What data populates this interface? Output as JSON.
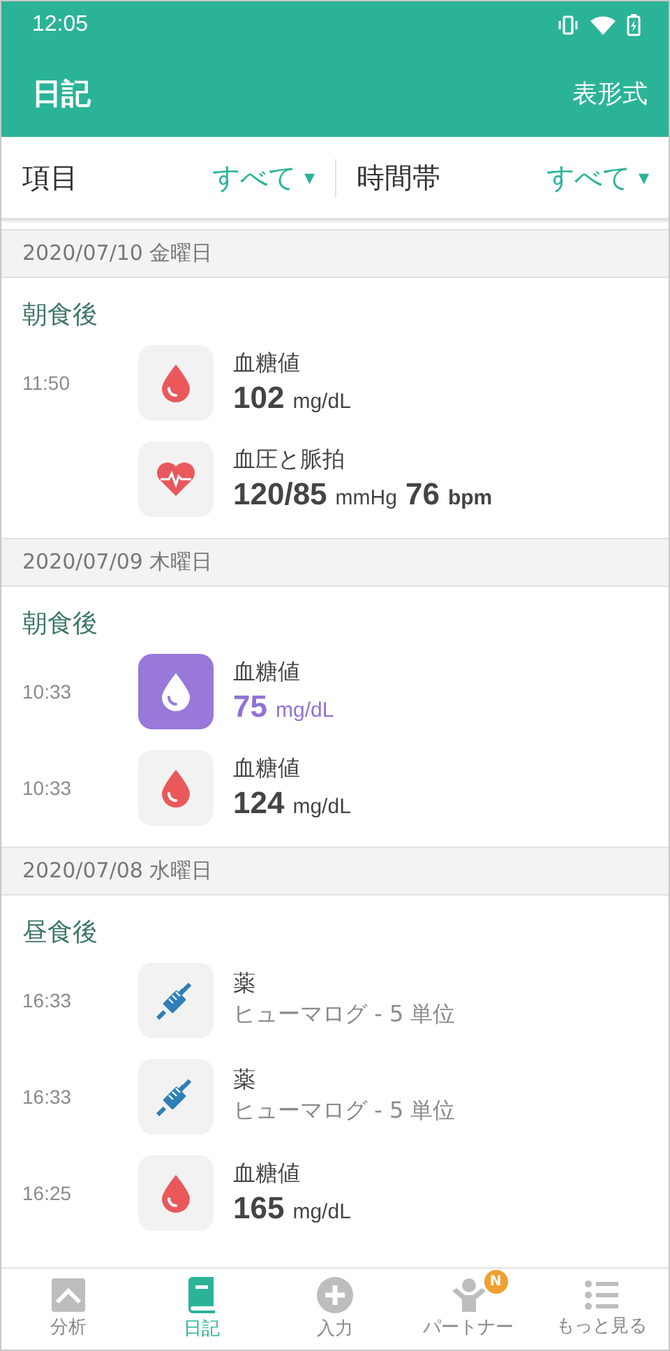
{
  "status_bar": {
    "time": "12:05"
  },
  "app_bar": {
    "title": "日記",
    "action": "表形式"
  },
  "filters": [
    {
      "label": "項目",
      "value": "すべて",
      "caret": "▾"
    },
    {
      "label": "時間帯",
      "value": "すべて",
      "caret": "▾"
    }
  ],
  "days": [
    {
      "date": "2020/07/10 金曜日",
      "groups": [
        {
          "title": "朝食後",
          "entries": [
            {
              "kind": "glucose",
              "time": "11:50",
              "name": "血糖値",
              "value": "102",
              "unit": "mg/dL",
              "highlighted": false
            },
            {
              "kind": "pressure",
              "name": "血圧と脈拍",
              "value": "120/85",
              "unit": "mmHg",
              "value2": "76",
              "unit2": "bpm"
            }
          ]
        }
      ]
    },
    {
      "date": "2020/07/09 木曜日",
      "groups": [
        {
          "title": "朝食後",
          "entries": [
            {
              "kind": "glucose",
              "time": "10:33",
              "name": "血糖値",
              "value": "75",
              "unit": "mg/dL",
              "highlighted": true
            },
            {
              "kind": "glucose",
              "time": "10:33",
              "name": "血糖値",
              "value": "124",
              "unit": "mg/dL",
              "highlighted": false
            }
          ]
        }
      ]
    },
    {
      "date": "2020/07/08 水曜日",
      "groups": [
        {
          "title": "昼食後",
          "entries": [
            {
              "kind": "medication",
              "time": "16:33",
              "name": "薬",
              "detail": "ヒューマログ - 5 単位"
            },
            {
              "kind": "medication",
              "time": "16:33",
              "name": "薬",
              "detail": "ヒューマログ - 5 単位"
            },
            {
              "kind": "glucose",
              "time": "16:25",
              "name": "血糖値",
              "value": "165",
              "unit": "mg/dL",
              "highlighted": false
            }
          ]
        }
      ]
    }
  ],
  "nav": [
    {
      "kind": "chart",
      "label": "分析",
      "selected": false
    },
    {
      "kind": "book",
      "label": "日記",
      "selected": true
    },
    {
      "kind": "plus",
      "label": "入力",
      "selected": false
    },
    {
      "kind": "person",
      "label": "パートナー",
      "selected": false,
      "badge": "N"
    },
    {
      "kind": "list",
      "label": "もっと見る",
      "selected": false
    }
  ]
}
